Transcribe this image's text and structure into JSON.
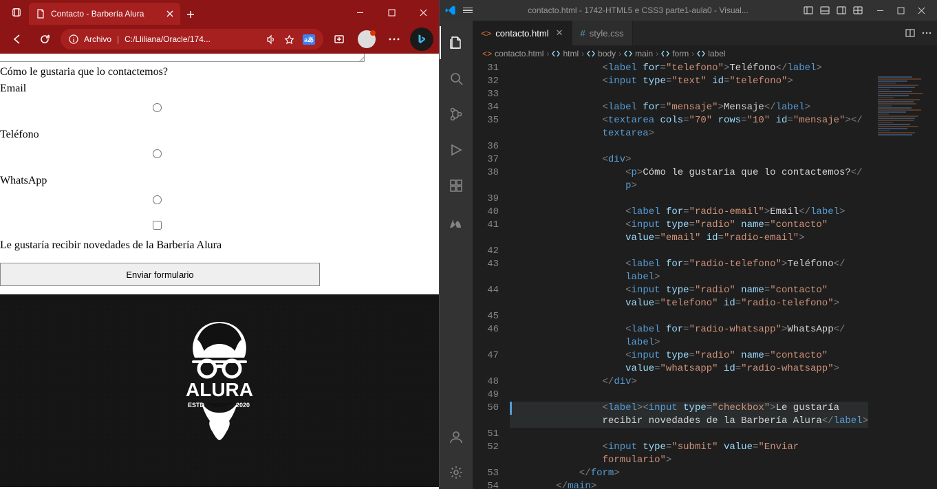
{
  "browser": {
    "tab_title": "Contacto - Barbería Alura",
    "url_scheme": "Archivo",
    "url": "C:/Lliliana/Oracle/174..."
  },
  "form": {
    "question": "Cómo le gustaria que lo contactemos?",
    "option_email": "Email",
    "option_telefono": "Teléfono",
    "option_whatsapp": "WhatsApp",
    "newsletter": "Le gustaría recibir novedades de la Barbería Alura",
    "submit": "Enviar formulario"
  },
  "logo": {
    "name": "ALURA",
    "estd": "ESTD",
    "year": "2020"
  },
  "vscode": {
    "title": "contacto.html - 1742-HTML5 e CSS3 parte1-aula0 - Visual...",
    "tabs": [
      {
        "label": "contacto.html",
        "active": true
      },
      {
        "label": "style.css",
        "active": false
      }
    ],
    "breadcrumb": [
      "contacto.html",
      "html",
      "body",
      "main",
      "form",
      "label"
    ],
    "line_start": 31,
    "line_end": 54
  },
  "code": {
    "l31": {
      "pre": "                ",
      "tag_open_label": "label",
      "attr_for": "for",
      "val_for": "telefono",
      "text": "Teléfono",
      "tag_close_label": "label"
    },
    "l32": {
      "pre": "                ",
      "tag": "input",
      "attr_type": "type",
      "val_type": "text",
      "attr_id": "id",
      "val_id": "telefono"
    },
    "l34": {
      "pre": "                ",
      "tag_open": "label",
      "attr": "for",
      "val": "mensaje",
      "text": "Mensaje",
      "tag_close": "label"
    },
    "l35a": {
      "pre": "                ",
      "tag": "textarea",
      "a1": "cols",
      "v1": "70",
      "a2": "rows",
      "v2": "10",
      "a3": "id",
      "v3": "mensaje"
    },
    "l35b": {
      "pre": "                ",
      "close": "textarea"
    },
    "l37": {
      "pre": "                ",
      "tag": "div"
    },
    "l38": {
      "pre": "                    ",
      "tag": "p",
      "text": "Cómo le gustaria que lo contactemos?"
    },
    "l38b": {
      "pre": "                    ",
      "close": "p"
    },
    "l40": {
      "pre": "                    ",
      "tag": "label",
      "a": "for",
      "v": "radio-email",
      "text": "Email",
      "close": "label"
    },
    "l41a": {
      "pre": "                    ",
      "tag": "input",
      "a1": "type",
      "v1": "radio",
      "a2": "name",
      "v2": "contacto"
    },
    "l41b": {
      "pre": "                    ",
      "a1": "value",
      "v1": "email",
      "a2": "id",
      "v2": "radio-email"
    },
    "l43a": {
      "pre": "                    ",
      "tag": "label",
      "a": "for",
      "v": "radio-telefono",
      "text": "Teléfono"
    },
    "l43b": {
      "pre": "                    ",
      "close": "label"
    },
    "l44a": {
      "pre": "                    ",
      "tag": "input",
      "a1": "type",
      "v1": "radio",
      "a2": "name",
      "v2": "contacto"
    },
    "l44b": {
      "pre": "                    ",
      "a1": "value",
      "v1": "telefono",
      "a2": "id",
      "v2": "radio-telefono"
    },
    "l46a": {
      "pre": "                    ",
      "tag": "label",
      "a": "for",
      "v": "radio-whatsapp",
      "text": "WhatsApp"
    },
    "l46b": {
      "pre": "                    ",
      "close": "label"
    },
    "l47a": {
      "pre": "                    ",
      "tag": "input",
      "a1": "type",
      "v1": "radio",
      "a2": "name",
      "v2": "contacto"
    },
    "l47b": {
      "pre": "                    ",
      "a1": "value",
      "v1": "whatsapp",
      "a2": "id",
      "v2": "radio-whatsapp"
    },
    "l48": {
      "pre": "                ",
      "close": "div"
    },
    "l50a": {
      "pre": "                ",
      "tag1": "label",
      "tag2": "input",
      "a": "type",
      "v": "checkbox",
      "text": "Le gustaría "
    },
    "l50b": {
      "pre": "                ",
      "text": "recibir novedades de la Barbería Alura",
      "close": "label"
    },
    "l52a": {
      "pre": "                ",
      "tag": "input",
      "a1": "type",
      "v1": "submit",
      "a2": "value",
      "v2": "Enviar "
    },
    "l52b": {
      "pre": "                ",
      "text": "formulario",
      "q": "\""
    },
    "l53": {
      "pre": "            ",
      "close": "form"
    },
    "l54": {
      "pre": "        ",
      "close": "main"
    }
  }
}
